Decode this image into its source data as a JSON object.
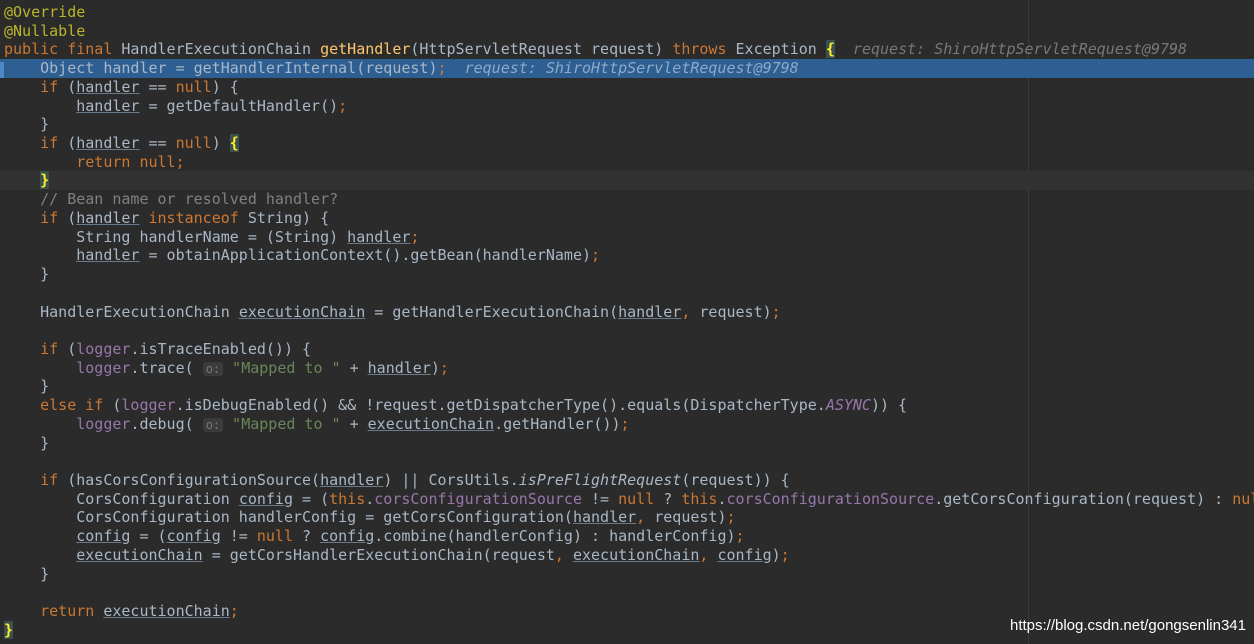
{
  "editor": {
    "colors": {
      "background": "#2b2b2b",
      "execution_line": "#2d5f93",
      "caret_line": "#323232",
      "keyword": "#cc7832",
      "annotation": "#bbb529",
      "method_declaration": "#ffc66d",
      "string": "#6a8759",
      "comment": "#808080",
      "field": "#9876aa"
    },
    "lines": [
      {
        "segments": [
          {
            "t": "@Override",
            "c": "ann"
          }
        ]
      },
      {
        "segments": [
          {
            "t": "@Nullable",
            "c": "ann"
          }
        ]
      },
      {
        "segments": [
          {
            "t": "public final ",
            "c": "kw"
          },
          {
            "t": "HandlerExecutionChain "
          },
          {
            "t": "getHandler",
            "c": "fn"
          },
          {
            "t": "(HttpServletRequest request) "
          },
          {
            "t": "throws ",
            "c": "kw"
          },
          {
            "t": "Exception "
          },
          {
            "t": "{",
            "c": "brace-match"
          },
          {
            "t": "  request: ShiroHttpServletRequest@9798",
            "c": "hint"
          }
        ]
      },
      {
        "highlight": "exec",
        "segments": [
          {
            "t": "    Object handler = getHandlerInternal(request)"
          },
          {
            "t": ";",
            "c": "kw"
          },
          {
            "t": "  request: ShiroHttpServletRequest@9798",
            "c": "hint"
          }
        ]
      },
      {
        "segments": [
          {
            "t": "    "
          },
          {
            "t": "if ",
            "c": "kw"
          },
          {
            "t": "("
          },
          {
            "t": "handler",
            "c": "ul"
          },
          {
            "t": " == "
          },
          {
            "t": "null",
            "c": "kw"
          },
          {
            "t": ") {"
          }
        ]
      },
      {
        "segments": [
          {
            "t": "        "
          },
          {
            "t": "handler",
            "c": "ul"
          },
          {
            "t": " = getDefaultHandler()"
          },
          {
            "t": ";",
            "c": "kw"
          }
        ]
      },
      {
        "segments": [
          {
            "t": "    }"
          }
        ]
      },
      {
        "segments": [
          {
            "t": "    "
          },
          {
            "t": "if ",
            "c": "kw"
          },
          {
            "t": "("
          },
          {
            "t": "handler",
            "c": "ul"
          },
          {
            "t": " == "
          },
          {
            "t": "null",
            "c": "kw"
          },
          {
            "t": ") "
          },
          {
            "t": "{",
            "c": "brace-match"
          }
        ]
      },
      {
        "segments": [
          {
            "t": "        "
          },
          {
            "t": "return null;",
            "c": "kw"
          }
        ]
      },
      {
        "highlight": "caret",
        "segments": [
          {
            "t": "    "
          },
          {
            "t": "}",
            "c": "brace-match"
          }
        ]
      },
      {
        "segments": [
          {
            "t": "    // Bean name or resolved handler?",
            "c": "cmt"
          }
        ]
      },
      {
        "segments": [
          {
            "t": "    "
          },
          {
            "t": "if ",
            "c": "kw"
          },
          {
            "t": "("
          },
          {
            "t": "handler",
            "c": "ul"
          },
          {
            "t": " "
          },
          {
            "t": "instanceof ",
            "c": "kw"
          },
          {
            "t": "String) {"
          }
        ]
      },
      {
        "segments": [
          {
            "t": "        String handlerName = (String) "
          },
          {
            "t": "handler",
            "c": "ul"
          },
          {
            "t": ";",
            "c": "kw"
          }
        ]
      },
      {
        "segments": [
          {
            "t": "        "
          },
          {
            "t": "handler",
            "c": "ul"
          },
          {
            "t": " = obtainApplicationContext().getBean(handlerName)"
          },
          {
            "t": ";",
            "c": "kw"
          }
        ]
      },
      {
        "segments": [
          {
            "t": "    }"
          }
        ]
      },
      {
        "segments": [
          {
            "t": ""
          }
        ]
      },
      {
        "segments": [
          {
            "t": "    HandlerExecutionChain "
          },
          {
            "t": "executionChain",
            "c": "ul"
          },
          {
            "t": " = getHandlerExecutionChain("
          },
          {
            "t": "handler",
            "c": "ul"
          },
          {
            "t": ", ",
            "c": "kw"
          },
          {
            "t": "request)"
          },
          {
            "t": ";",
            "c": "kw"
          }
        ]
      },
      {
        "segments": [
          {
            "t": ""
          }
        ]
      },
      {
        "segments": [
          {
            "t": "    "
          },
          {
            "t": "if ",
            "c": "kw"
          },
          {
            "t": "("
          },
          {
            "t": "logger",
            "c": "fld"
          },
          {
            "t": ".isTraceEnabled()) {"
          }
        ]
      },
      {
        "segments": [
          {
            "t": "        "
          },
          {
            "t": "logger",
            "c": "fld"
          },
          {
            "t": ".trace( "
          },
          {
            "t": "o:",
            "c": "param-hint"
          },
          {
            "t": " "
          },
          {
            "t": "\"Mapped to \"",
            "c": "str"
          },
          {
            "t": " + "
          },
          {
            "t": "handler",
            "c": "ul"
          },
          {
            "t": ")"
          },
          {
            "t": ";",
            "c": "kw"
          }
        ]
      },
      {
        "segments": [
          {
            "t": "    }"
          }
        ]
      },
      {
        "segments": [
          {
            "t": "    "
          },
          {
            "t": "else if ",
            "c": "kw"
          },
          {
            "t": "("
          },
          {
            "t": "logger",
            "c": "fld"
          },
          {
            "t": ".isDebugEnabled() && !request.getDispatcherType().equals(DispatcherType."
          },
          {
            "t": "ASYNC",
            "c": "fld st"
          },
          {
            "t": ")) {"
          }
        ]
      },
      {
        "segments": [
          {
            "t": "        "
          },
          {
            "t": "logger",
            "c": "fld"
          },
          {
            "t": ".debug( "
          },
          {
            "t": "o:",
            "c": "param-hint"
          },
          {
            "t": " "
          },
          {
            "t": "\"Mapped to \"",
            "c": "str"
          },
          {
            "t": " + "
          },
          {
            "t": "executionChain",
            "c": "ul"
          },
          {
            "t": ".getHandler())"
          },
          {
            "t": ";",
            "c": "kw"
          }
        ]
      },
      {
        "segments": [
          {
            "t": "    }"
          }
        ]
      },
      {
        "segments": [
          {
            "t": ""
          }
        ]
      },
      {
        "segments": [
          {
            "t": "    "
          },
          {
            "t": "if ",
            "c": "kw"
          },
          {
            "t": "(hasCorsConfigurationSource("
          },
          {
            "t": "handler",
            "c": "ul"
          },
          {
            "t": ") || CorsUtils."
          },
          {
            "t": "isPreFlightRequest",
            "c": "st"
          },
          {
            "t": "(request)) {"
          }
        ]
      },
      {
        "segments": [
          {
            "t": "        CorsConfiguration "
          },
          {
            "t": "config",
            "c": "ul"
          },
          {
            "t": " = ("
          },
          {
            "t": "this",
            "c": "kw"
          },
          {
            "t": "."
          },
          {
            "t": "corsConfigurationSource",
            "c": "fld"
          },
          {
            "t": " != "
          },
          {
            "t": "null ",
            "c": "kw"
          },
          {
            "t": "? "
          },
          {
            "t": "this",
            "c": "kw"
          },
          {
            "t": "."
          },
          {
            "t": "corsConfigurationSource",
            "c": "fld"
          },
          {
            "t": ".getCorsConfiguration(request) : "
          },
          {
            "t": "null",
            "c": "kw"
          },
          {
            "t": ")"
          },
          {
            "t": ";",
            "c": "kw"
          }
        ]
      },
      {
        "segments": [
          {
            "t": "        CorsConfiguration handlerConfig = getCorsConfiguration("
          },
          {
            "t": "handler",
            "c": "ul"
          },
          {
            "t": ", ",
            "c": "kw"
          },
          {
            "t": "request)"
          },
          {
            "t": ";",
            "c": "kw"
          }
        ]
      },
      {
        "segments": [
          {
            "t": "        "
          },
          {
            "t": "config",
            "c": "ul"
          },
          {
            "t": " = ("
          },
          {
            "t": "config",
            "c": "ul"
          },
          {
            "t": " != "
          },
          {
            "t": "null ",
            "c": "kw"
          },
          {
            "t": "? "
          },
          {
            "t": "config",
            "c": "ul"
          },
          {
            "t": ".combine(handlerConfig) : handlerConfig)"
          },
          {
            "t": ";",
            "c": "kw"
          }
        ]
      },
      {
        "segments": [
          {
            "t": "        "
          },
          {
            "t": "executionChain",
            "c": "ul"
          },
          {
            "t": " = getCorsHandlerExecutionChain(request"
          },
          {
            "t": ", ",
            "c": "kw"
          },
          {
            "t": "executionChain",
            "c": "ul"
          },
          {
            "t": ", ",
            "c": "kw"
          },
          {
            "t": "config",
            "c": "ul"
          },
          {
            "t": ")"
          },
          {
            "t": ";",
            "c": "kw"
          }
        ]
      },
      {
        "segments": [
          {
            "t": "    }"
          }
        ]
      },
      {
        "segments": [
          {
            "t": ""
          }
        ]
      },
      {
        "segments": [
          {
            "t": "    "
          },
          {
            "t": "return ",
            "c": "kw"
          },
          {
            "t": "executionChain",
            "c": "ul"
          },
          {
            "t": ";",
            "c": "kw"
          }
        ]
      },
      {
        "segments": [
          {
            "t": "}",
            "c": "brace-match"
          }
        ]
      }
    ]
  },
  "watermark": "https://blog.csdn.net/gongsenlin341"
}
